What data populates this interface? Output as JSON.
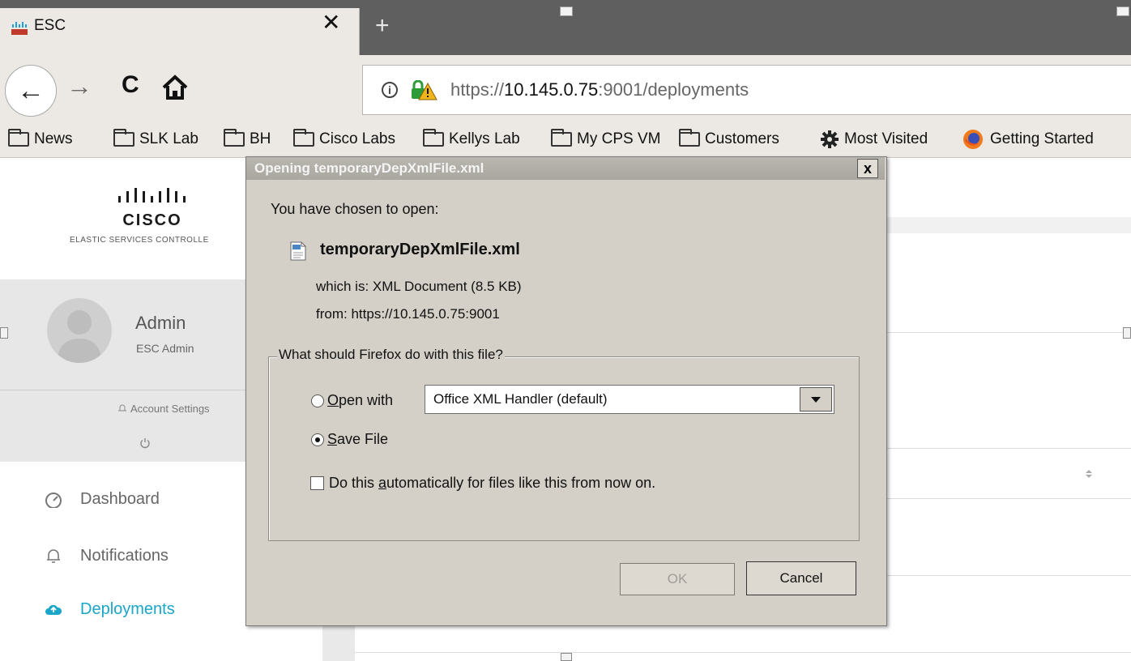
{
  "tab": {
    "title": "ESC",
    "close": "✕",
    "new_tab": "+"
  },
  "nav_buttons": {
    "back": "←",
    "forward": "→",
    "reload": "C"
  },
  "address": {
    "info": "i",
    "scheme": "https://",
    "host": "10.145.0.75",
    "rest": ":9001/deployments"
  },
  "bookmarks": [
    {
      "label": "News",
      "icon": "folder-icon"
    },
    {
      "label": "SLK Lab",
      "icon": "folder-icon"
    },
    {
      "label": "BH",
      "icon": "folder-icon"
    },
    {
      "label": "Cisco Labs",
      "icon": "folder-icon"
    },
    {
      "label": "Kellys Lab",
      "icon": "folder-icon"
    },
    {
      "label": "My CPS VM",
      "icon": "folder-icon"
    },
    {
      "label": "Customers",
      "icon": "folder-icon"
    },
    {
      "label": "Most Visited",
      "icon": "gear-icon"
    },
    {
      "label": "Getting Started",
      "icon": "firefox-icon"
    }
  ],
  "brand": {
    "logo_text": "CISCO",
    "subtitle": "ELASTIC SERVICES CONTROLLE"
  },
  "user": {
    "name": "Admin",
    "role": "ESC Admin",
    "account_settings": "Account Settings"
  },
  "nav": [
    {
      "label": "Dashboard",
      "icon": "dashboard-icon",
      "active": false
    },
    {
      "label": "Notifications",
      "icon": "bell-icon",
      "active": false
    },
    {
      "label": "Deployments",
      "icon": "cloud-upload-icon",
      "active": true
    }
  ],
  "dialog": {
    "title": "Opening temporaryDepXmlFile.xml",
    "close": "x",
    "prompt": "You have chosen to open:",
    "file_name": "temporaryDepXmlFile.xml",
    "which_is_label": "which is:",
    "which_is_value": "XML Document (8.5 KB)",
    "from_label": "from:",
    "from_value": "https://10.145.0.75:9001",
    "group_title": "What should Firefox do with this file?",
    "open_with_key": "O",
    "open_with_rest": "pen with",
    "open_with_value": "Office XML Handler (default)",
    "save_file_key": "S",
    "save_file_rest": "ave File",
    "selected_option": "save_file",
    "auto_pre": "Do this ",
    "auto_key": "a",
    "auto_rest": "utomatically for files like this from now on.",
    "auto_checked": false,
    "ok_label": "OK",
    "cancel_label": "Cancel"
  },
  "colors": {
    "accent": "#19a6c9",
    "dialog_bg": "#d4d0c8",
    "chrome_bg": "#ece9e4"
  }
}
